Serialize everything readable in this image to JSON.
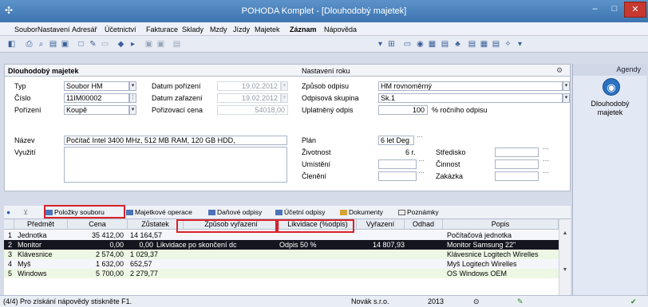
{
  "window": {
    "title": "POHODA Komplet - [Dlouhodobý majetek]"
  },
  "menu": [
    "Soubor",
    "Nastavení",
    "Adresář",
    "Účetnictví",
    "Fakturace",
    "Sklady",
    "Mzdy",
    "Jízdy",
    "Majetek",
    "Záznam",
    "Nápověda"
  ],
  "form": {
    "header": "Dlouhodobý majetek",
    "section2": "Nastavení roku",
    "typ_label": "Typ",
    "typ_value": "Soubor HM",
    "cislo_label": "Číslo",
    "cislo_value": "11IM00002",
    "porizeni_label": "Pořízení",
    "porizeni_value": "Koupě",
    "datum_porizeni_label": "Datum pořízení",
    "datum_porizeni_value": "19.02.2012",
    "datum_zarazeni_label": "Datum zařazení",
    "datum_zarazeni_value": "19.02.2012",
    "porizovaci_cena_label": "Pořizovací cena",
    "porizovaci_cena_value": "54018,00",
    "zpusob_odpisu_label": "Způsob odpisu",
    "zpusob_odpisu_value": "HM rovnoměrný",
    "odpisova_skupina_label": "Odpisová skupina",
    "odpisova_skupina_value": "Sk.1",
    "uplatneny_odpis_label": "Uplatněný odpis",
    "uplatneny_odpis_value": "100",
    "uplatneny_odpis_suffix": "% ročního odpisu",
    "nazev_label": "Název",
    "nazev_value": "Počítač Intel 3400 MHz, 512 MB RAM, 120 GB HDD,",
    "vyuziti_label": "Využití",
    "plan_label": "Plán",
    "plan_value": "6 let Deg",
    "zivotnost_label": "Životnost",
    "zivotnost_value": "6 r.",
    "umisteni_label": "Umístění",
    "cleneni_label": "Členění",
    "stredisko_label": "Středisko",
    "cinnost_label": "Činnost",
    "zakazka_label": "Zakázka"
  },
  "agendy": {
    "header": "Agendy",
    "item": "Dlouhodobý majetek"
  },
  "tabs": [
    "Položky souboru",
    "Majetkové operace",
    "Daňové odpisy",
    "Účetní odpisy",
    "Dokumenty",
    "Poznámky"
  ],
  "grid": {
    "columns": [
      "Předmět",
      "Cena",
      "Zůstatek",
      "Způsob vyřazení",
      "Likvidace (%odpis)",
      "Vyřazení",
      "Odhad",
      "Popis"
    ],
    "rows": [
      {
        "n": "1",
        "predmet": "Jednotka",
        "cena": "35 412,00",
        "zustatek": "14 164,57",
        "zpusob": "",
        "likvidace": "",
        "vyrazeni": "",
        "odhad": "",
        "popis": "Počítačová jednotka"
      },
      {
        "n": "2",
        "predmet": "Monitor",
        "cena": "0,00",
        "zustatek": "0,00",
        "zpusob": "Likvidace po skončení dc",
        "likvidace": "Odpis 50 %",
        "vyrazeni": "14 807,93",
        "odhad": "",
        "popis": "Monitor Samsung 22\""
      },
      {
        "n": "3",
        "predmet": "Klávesnice",
        "cena": "2 574,00",
        "zustatek": "1 029,37",
        "zpusob": "",
        "likvidace": "",
        "vyrazeni": "",
        "odhad": "",
        "popis": "Klávesnice Logitech Wirelles"
      },
      {
        "n": "4",
        "predmet": "Myš",
        "cena": "1 632,00",
        "zustatek": "652,57",
        "zpusob": "",
        "likvidace": "",
        "vyrazeni": "",
        "odhad": "",
        "popis": "Myš Logitech Wirelles"
      },
      {
        "n": "5",
        "predmet": "Windows",
        "cena": "5 700,00",
        "zustatek": "2 279,77",
        "zpusob": "",
        "likvidace": "",
        "vyrazeni": "",
        "odhad": "",
        "popis": "OS Windows OEM"
      }
    ]
  },
  "status": {
    "help": "(4/4) Pro získání nápovědy stiskněte F1.",
    "company": "Novák s.r.o.",
    "year": "2013"
  }
}
